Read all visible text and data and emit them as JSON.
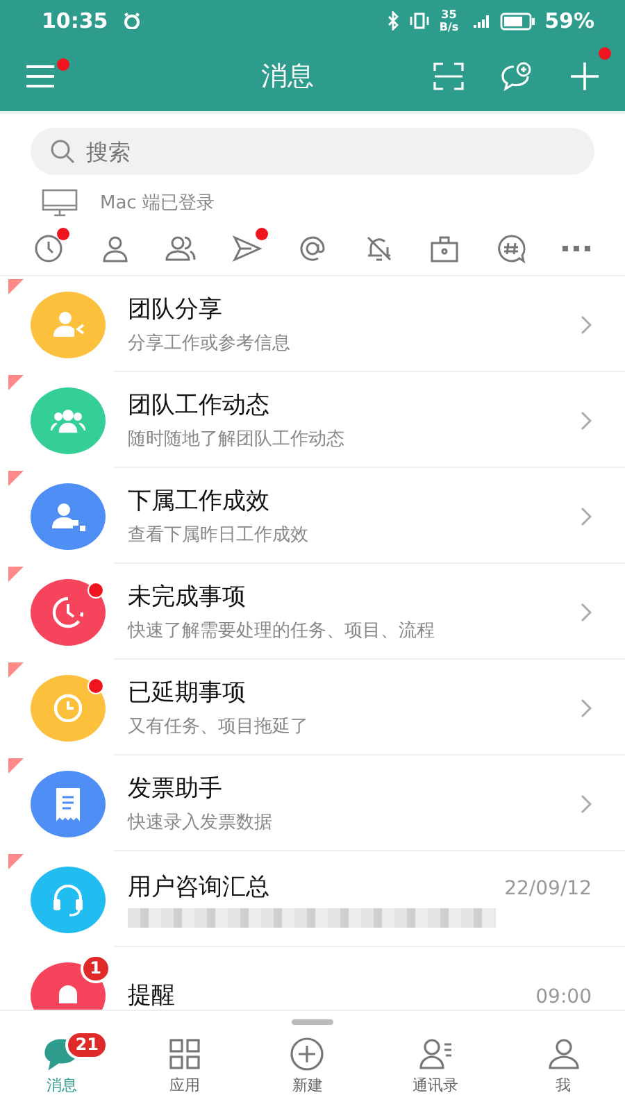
{
  "status_bar": {
    "time": "10:35",
    "net_speed_value": "35",
    "net_speed_unit": "B/s",
    "battery": "59%"
  },
  "header": {
    "title": "消息",
    "menu_dot": true,
    "add_dot": true
  },
  "search": {
    "placeholder": "搜索"
  },
  "device_notice": "Mac 端已登录",
  "filters": [
    {
      "kind": "recent",
      "dot": true
    },
    {
      "kind": "person",
      "dot": false
    },
    {
      "kind": "group",
      "dot": false
    },
    {
      "kind": "sent",
      "dot": true
    },
    {
      "kind": "mention",
      "dot": false
    },
    {
      "kind": "muted",
      "dot": false
    },
    {
      "kind": "work",
      "dot": false
    },
    {
      "kind": "topic",
      "dot": false
    },
    {
      "kind": "more",
      "dot": false
    }
  ],
  "conversations": [
    {
      "color": "#fcc03c",
      "title": "团队分享",
      "subtitle": "分享工作或参考信息",
      "pinned": true,
      "dot": false,
      "chevron": true
    },
    {
      "color": "#34cf96",
      "title": "团队工作动态",
      "subtitle": "随时随地了解团队工作动态",
      "pinned": true,
      "dot": false,
      "chevron": true
    },
    {
      "color": "#4f8ef5",
      "title": "下属工作成效",
      "subtitle": "查看下属昨日工作成效",
      "pinned": true,
      "dot": false,
      "chevron": true
    },
    {
      "color": "#f5445c",
      "title": "未完成事项",
      "subtitle": "快速了解需要处理的任务、项目、流程",
      "pinned": true,
      "dot": true,
      "chevron": true
    },
    {
      "color": "#fcc03c",
      "title": "已延期事项",
      "subtitle": "又有任务、项目拖延了",
      "pinned": true,
      "dot": true,
      "chevron": true
    },
    {
      "color": "#4f8ef5",
      "title": "发票助手",
      "subtitle": "快速录入发票数据",
      "pinned": true,
      "dot": false,
      "chevron": true
    },
    {
      "color": "#22bdf0",
      "title": "用户咨询汇总",
      "time": "22/09/12",
      "pinned": true,
      "dot": false,
      "chevron": false
    },
    {
      "color": "#f5445c",
      "title": "提醒",
      "time": "09:00",
      "badge": "1",
      "pinned": false,
      "dot": false,
      "chevron": false
    }
  ],
  "bottom_nav": [
    {
      "label": "消息",
      "badge": "21",
      "selected": true
    },
    {
      "label": "应用",
      "selected": false
    },
    {
      "label": "新建",
      "selected": false
    },
    {
      "label": "通讯录",
      "selected": false
    },
    {
      "label": "我",
      "selected": false
    }
  ]
}
